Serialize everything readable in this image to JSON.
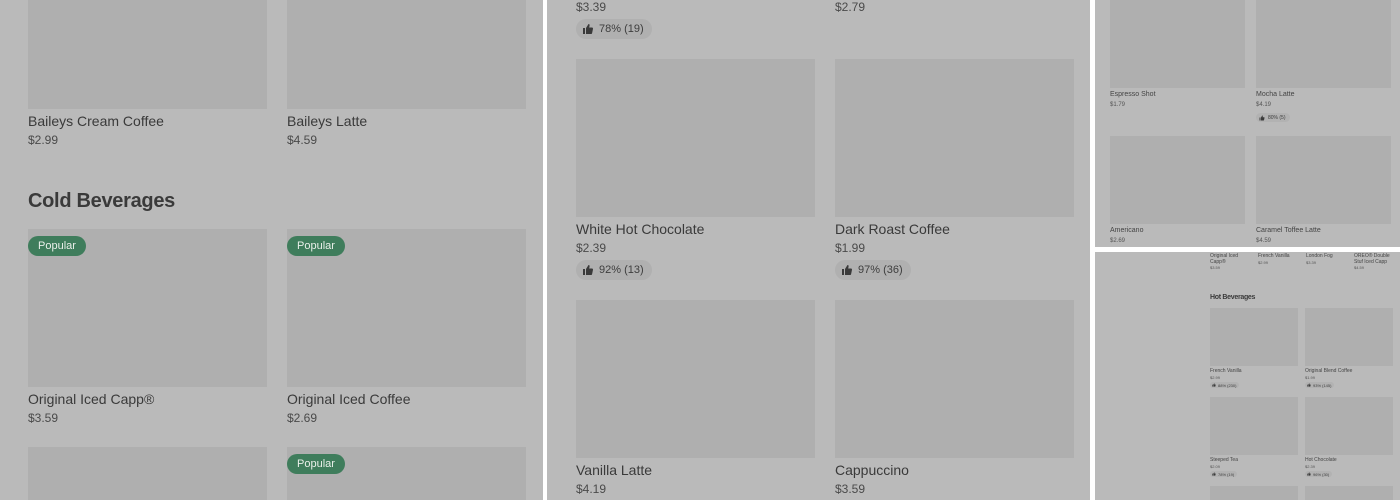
{
  "panel1": {
    "items_top": [
      {
        "name": "Baileys Cream Coffee",
        "price": "$2.99"
      },
      {
        "name": "Baileys Latte",
        "price": "$4.59"
      }
    ],
    "section_title": "Cold Beverages",
    "items_cold": [
      {
        "name": "Original Iced Capp®",
        "price": "$3.59",
        "badge": "Popular"
      },
      {
        "name": "Original Iced Coffee",
        "price": "$2.69",
        "badge": "Popular"
      }
    ],
    "next_badge": "Popular"
  },
  "panel2": {
    "top_prices": [
      "$3.39",
      "$2.79"
    ],
    "top_rating": "78% (19)",
    "items": [
      {
        "name": "White Hot Chocolate",
        "price": "$2.39",
        "rating": "92% (13)"
      },
      {
        "name": "Dark Roast Coffee",
        "price": "$1.99",
        "rating": "97% (36)"
      },
      {
        "name": "Vanilla Latte",
        "price": "$4.19"
      },
      {
        "name": "Cappuccino",
        "price": "$3.59"
      }
    ]
  },
  "panel3": {
    "items": [
      {
        "name": "Espresso Shot",
        "price": "$1.79"
      },
      {
        "name": "Mocha Latte",
        "price": "$4.19",
        "rating": "80% (5)"
      },
      {
        "name": "Americano",
        "price": "$2.69"
      },
      {
        "name": "Caramel Toffee Latte",
        "price": "$4.59"
      }
    ]
  },
  "panel4": {
    "top_items": [
      {
        "name": "Original Iced Capp®",
        "price": "$3.59"
      },
      {
        "name": "French Vanilla",
        "price": "$2.99"
      },
      {
        "name": "London Fog",
        "price": "$3.39"
      },
      {
        "name": "OREO® Double Stuf Iced Capp",
        "price": "$4.59"
      }
    ],
    "section_title": "Hot Beverages",
    "items": [
      {
        "name": "French Vanilla",
        "price": "$2.99",
        "rating": "88% (230)"
      },
      {
        "name": "Original Blend Coffee",
        "price": "$1.99",
        "rating": "93% (145)"
      },
      {
        "name": "Steeped Tea",
        "price": "$2.09",
        "rating": "78% (19)"
      },
      {
        "name": "Hot Chocolate",
        "price": "$2.39",
        "rating": "96% (30)"
      }
    ]
  },
  "icons": {
    "rating": "thumbs-up-icon"
  },
  "colors": {
    "badge": "#3f7d5c",
    "overlay": "#bababa"
  }
}
